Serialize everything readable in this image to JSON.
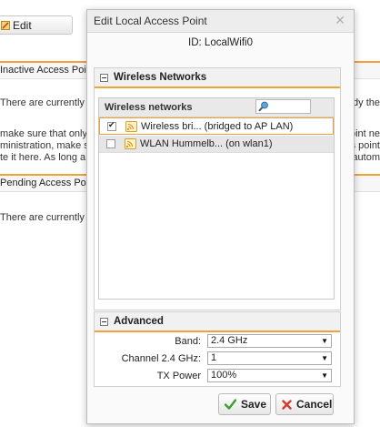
{
  "background": {
    "edit_button_label": "Edit",
    "inactive_heading": "Inactive Access Points",
    "inactive_empty_left": "There are currently no",
    "inactive_empty_right": "dy the",
    "info_line1_left": "make sure that only",
    "info_line1_right": "oint ne",
    "info_line2_left": "ministration, make su",
    "info_line2_right": "s point",
    "info_line3_left": "te it here. As long a",
    "info_line3_right": "autom",
    "pending_heading": "Pending Access Points",
    "pending_empty_left": "There are currently no"
  },
  "dialog": {
    "title": "Edit Local Access Point",
    "close_symbol": "✕",
    "id_line": "ID: LocalWifi0",
    "wireless_section": {
      "title": "Wireless Networks",
      "grid_header": "Wireless networks",
      "search_placeholder": "",
      "rows": [
        {
          "checked": true,
          "label": "Wireless bri... (bridged to AP LAN)"
        },
        {
          "checked": false,
          "label": "WLAN Hummelb... (on wlan1)"
        }
      ]
    },
    "advanced_section": {
      "title": "Advanced",
      "band_label": "Band:",
      "band_value": "2.4 GHz",
      "channel_label": "Channel 2.4 GHz:",
      "channel_value": "1",
      "txpower_label": "TX Power",
      "txpower_value": "100%"
    },
    "buttons": {
      "save": "Save",
      "cancel": "Cancel"
    }
  },
  "colors": {
    "accent_orange": "#f1a13a",
    "save_check_green": "#3d9b2f",
    "cancel_x_red": "#d23b2f"
  }
}
